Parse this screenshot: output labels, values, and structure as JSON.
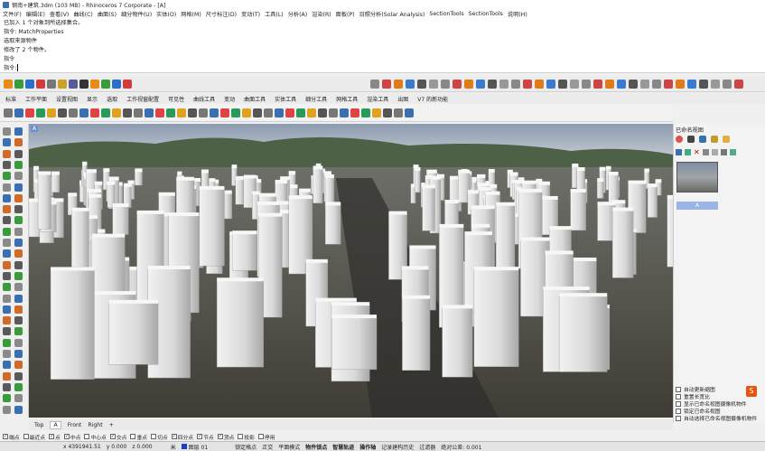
{
  "window": {
    "title": "钢南+建筑.3dm (103 MB) - Rhinoceros 7 Corporate - [A]"
  },
  "menu": [
    "文件(F)",
    "编辑(E)",
    "查看(V)",
    "曲线(C)",
    "曲面(S)",
    "细分物件(U)",
    "实体(O)",
    "网格(M)",
    "尺寸标注(D)",
    "变动(T)",
    "工具(L)",
    "分析(A)",
    "渲染(R)",
    "面板(P)",
    "日照分析(Solar Analysis)",
    "SectionTools",
    "SectionTools",
    "说明(H)"
  ],
  "command_history": [
    "已加入 1 个对象到所选择集合。",
    "指令: MatchProperties",
    "选取来源物件",
    "修改了 2 个物件。",
    "指令"
  ],
  "command_prompt": "指令:",
  "tabs": [
    "标准",
    "工作平面",
    "设置视图",
    "显示",
    "选取",
    "工作视窗配置",
    "可见性",
    "曲线工具",
    "变动",
    "曲面工具",
    "实体工具",
    "细分工具",
    "网格工具",
    "渲染工具",
    "出图",
    "V7 的新功能"
  ],
  "viewport": {
    "label": "A",
    "tabs": [
      "Top",
      "A",
      "Front",
      "Right",
      "+"
    ]
  },
  "right_panel": {
    "title": "已命名视图",
    "thumb_label": "A",
    "options": [
      "自动更新缩图",
      "重置长宽比",
      "显示已命名视图摄像机物件",
      "锁定已命名视图",
      "自动选择已命名视图摄像机物件"
    ]
  },
  "osnap": [
    {
      "label": "端点",
      "checked": true
    },
    {
      "label": "最近点",
      "checked": false
    },
    {
      "label": "点",
      "checked": true
    },
    {
      "label": "中点",
      "checked": true
    },
    {
      "label": "中心点",
      "checked": false
    },
    {
      "label": "交点",
      "checked": true
    },
    {
      "label": "垂点",
      "checked": false
    },
    {
      "label": "切点",
      "checked": false
    },
    {
      "label": "四分点",
      "checked": true
    },
    {
      "label": "节点",
      "checked": true
    },
    {
      "label": "顶点",
      "checked": true
    },
    {
      "label": "投影",
      "checked": false
    },
    {
      "label": "停用",
      "checked": false
    }
  ],
  "status": {
    "x": "x 4391941.51",
    "y": "y 0.000",
    "z": "z 0.000",
    "unit": "米",
    "layer": "图层 01",
    "items": [
      "锁定格点",
      "正交",
      "平面模式",
      "物件锁点",
      "智慧轨迹",
      "操作轴",
      "记录建构历史",
      "过滤器",
      "绝对公差: 0.001"
    ]
  },
  "colors": {
    "accent": "#3a6fb0",
    "tab_active": "#9bb4e6"
  }
}
